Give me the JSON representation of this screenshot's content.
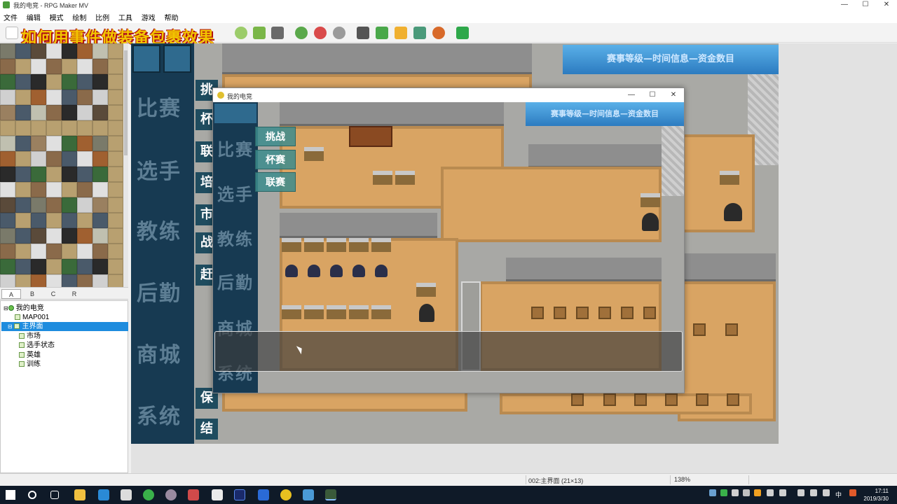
{
  "window": {
    "title": "我的电竞 - RPG Maker MV",
    "controls": [
      "—",
      "☐",
      "✕"
    ]
  },
  "menu": [
    "文件",
    "编辑",
    "模式",
    "绘制",
    "比例",
    "工具",
    "游戏",
    "帮助"
  ],
  "overlay_title": "如何用事件做装备包裹效果",
  "tile_tabs": [
    "A",
    "B",
    "C",
    "R"
  ],
  "map_tree": [
    {
      "label": "我的电竞",
      "level": 0,
      "selected": false
    },
    {
      "label": "MAP001",
      "level": 1,
      "selected": false
    },
    {
      "label": "主界面",
      "level": 1,
      "selected": true
    },
    {
      "label": "市场",
      "level": 2,
      "selected": false
    },
    {
      "label": "选手状态",
      "level": 2,
      "selected": false
    },
    {
      "label": "英雄",
      "level": 2,
      "selected": false
    },
    {
      "label": "训练",
      "level": 2,
      "selected": false
    }
  ],
  "map": {
    "side_menu": [
      "比赛",
      "选手",
      "教练",
      "后勤",
      "商城",
      "系统"
    ],
    "side_small": [
      "挑",
      "杯",
      "联",
      "培",
      "市",
      "战",
      "赶",
      "保",
      "结"
    ],
    "banner": "赛事等级—时间信息—资金数目"
  },
  "game_window": {
    "title": "我的电竞",
    "controls": [
      "—",
      "☐",
      "✕"
    ],
    "side_menu": [
      "比赛",
      "选手",
      "教练",
      "后勤",
      "商城",
      "系统"
    ],
    "commands": [
      "挑战",
      "杯赛",
      "联赛"
    ],
    "banner": "赛事等级—时间信息—资金数目"
  },
  "status_bar": {
    "map_info": "002:主界面 (21×13)",
    "zoom": "138%"
  },
  "taskbar": {
    "time": "17:11",
    "date": "2019/3/30",
    "ime": "中"
  },
  "colors": {
    "accent": "#1e8cde",
    "floor": "#d9a463",
    "title_yellow": "#f2c400",
    "title_red": "#b01010"
  }
}
